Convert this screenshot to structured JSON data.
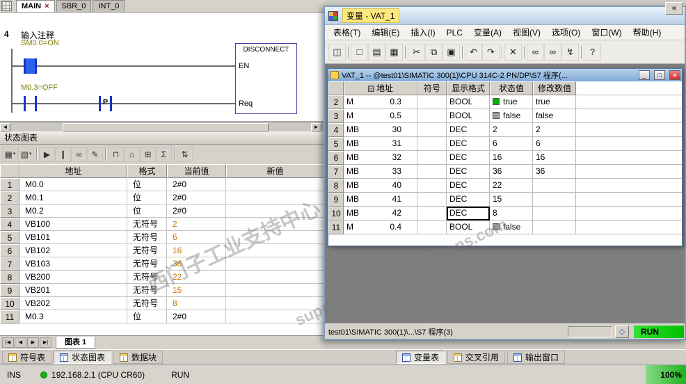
{
  "watermark": {
    "cn": "西门子工业支持中心",
    "url": "support.industry.siemens.com"
  },
  "icons": {
    "close": "×",
    "dropdown": "▾",
    "scroll_left": "◄",
    "scroll_right": "►",
    "nav_first": "|◀",
    "nav_prev": "◀",
    "nav_next": "▶",
    "nav_last": "▶|",
    "win_min": "_",
    "win_max": "□",
    "win_close": "×",
    "diamond": "◇",
    "collapse": "«",
    "chart_toolbar": [
      "▦",
      "▧",
      "▶",
      "∥",
      "∞",
      "✎",
      "⊓",
      "⌂",
      "⊞",
      "Σ",
      "⇅"
    ],
    "vat_toolbar": [
      "◫",
      "□",
      "▤",
      "▦",
      "✂",
      "⧉",
      "▣",
      "↶",
      "↷",
      "✕",
      "∞",
      "∞",
      "↯",
      "?"
    ]
  },
  "colors": {
    "status_true": "#00b400",
    "status_false": "#9aa0a0",
    "run_green": "#00c000",
    "label_olive": "#7f7b00",
    "value_orange": "#c47600"
  },
  "micro": {
    "tabs": [
      {
        "label": "MAIN"
      },
      {
        "label": "SBR_0"
      },
      {
        "label": "INT_0"
      }
    ],
    "ladder": {
      "network_no": "4",
      "comment": "输入注释",
      "contact1": "SM0.0=ON",
      "contact2": "M0.3=OFF",
      "edge": "P",
      "block": "DISCONNECT",
      "en": "EN",
      "req": "Req"
    },
    "chart": {
      "panel_title": "状态图表",
      "columns": [
        "地址",
        "格式",
        "当前值",
        "新值"
      ],
      "rows": [
        {
          "n": "1",
          "addr": "M0.0",
          "fmt": "位",
          "cur": "2#0",
          "nv": ""
        },
        {
          "n": "2",
          "addr": "M0.1",
          "fmt": "位",
          "cur": "2#0",
          "nv": ""
        },
        {
          "n": "3",
          "addr": "M0.2",
          "fmt": "位",
          "cur": "2#0",
          "nv": ""
        },
        {
          "n": "4",
          "addr": "VB100",
          "fmt": "无符号",
          "cur": "2",
          "nv": ""
        },
        {
          "n": "5",
          "addr": "VB101",
          "fmt": "无符号",
          "cur": "6",
          "nv": ""
        },
        {
          "n": "6",
          "addr": "VB102",
          "fmt": "无符号",
          "cur": "16",
          "nv": ""
        },
        {
          "n": "7",
          "addr": "VB103",
          "fmt": "无符号",
          "cur": "36",
          "nv": ""
        },
        {
          "n": "8",
          "addr": "VB200",
          "fmt": "无符号",
          "cur": "22",
          "nv": ""
        },
        {
          "n": "9",
          "addr": "VB201",
          "fmt": "无符号",
          "cur": "15",
          "nv": ""
        },
        {
          "n": "10",
          "addr": "VB202",
          "fmt": "无符号",
          "cur": "8",
          "nv": ""
        },
        {
          "n": "11",
          "addr": "M0.3",
          "fmt": "位",
          "cur": "2#0",
          "nv": ""
        }
      ],
      "sheet_tab": "图表 1"
    },
    "bottom_tabs": [
      "符号表",
      "状态图表",
      "数据块"
    ],
    "status": {
      "ins": "INS",
      "conn": "192.168.2.1 (CPU CR60)",
      "mode": "RUN"
    }
  },
  "vat": {
    "title": "变量 - VAT_1",
    "menus": [
      "表格(T)",
      "编辑(E)",
      "插入(I)",
      "PLC",
      "变量(A)",
      "视图(V)",
      "选项(O)",
      "窗口(W)",
      "帮助(H)"
    ],
    "doc_title": "VAT_1 -- @test01\\SIMATIC 300(1)\\CPU 314C-2 PN/DP\\S7 程序(...",
    "columns": [
      "地址",
      "符号",
      "显示格式",
      "状态值",
      "修改数值"
    ],
    "rows": [
      {
        "n": "2",
        "a": "M",
        "b": "0.3",
        "sym": "",
        "fmt": "BOOL",
        "st": "true",
        "mod": "true"
      },
      {
        "n": "3",
        "a": "M",
        "b": "0.5",
        "sym": "",
        "fmt": "BOOL",
        "st": "false",
        "mod": "false"
      },
      {
        "n": "4",
        "a": "MB",
        "b": "30",
        "sym": "",
        "fmt": "DEC",
        "st": "2",
        "mod": "2"
      },
      {
        "n": "5",
        "a": "MB",
        "b": "31",
        "sym": "",
        "fmt": "DEC",
        "st": "6",
        "mod": "6"
      },
      {
        "n": "6",
        "a": "MB",
        "b": "32",
        "sym": "",
        "fmt": "DEC",
        "st": "16",
        "mod": "16"
      },
      {
        "n": "7",
        "a": "MB",
        "b": "33",
        "sym": "",
        "fmt": "DEC",
        "st": "36",
        "mod": "36"
      },
      {
        "n": "8",
        "a": "MB",
        "b": "40",
        "sym": "",
        "fmt": "DEC",
        "st": "22",
        "mod": ""
      },
      {
        "n": "9",
        "a": "MB",
        "b": "41",
        "sym": "",
        "fmt": "DEC",
        "st": "15",
        "mod": ""
      },
      {
        "n": "10",
        "a": "MB",
        "b": "42",
        "sym": "",
        "fmt": "DEC",
        "st": "8",
        "mod": ""
      },
      {
        "n": "11",
        "a": "M",
        "b": "0.4",
        "sym": "",
        "fmt": "BOOL",
        "st": "false",
        "mod": ""
      }
    ],
    "statusbar": {
      "path": "test01\\SIMATIC 300(1)\\...\\S7 程序(3)",
      "mode": "RUN"
    }
  },
  "taskbar": {
    "buttons": [
      "变量表",
      "交叉引用",
      "输出窗口"
    ],
    "zoom": "100%"
  }
}
